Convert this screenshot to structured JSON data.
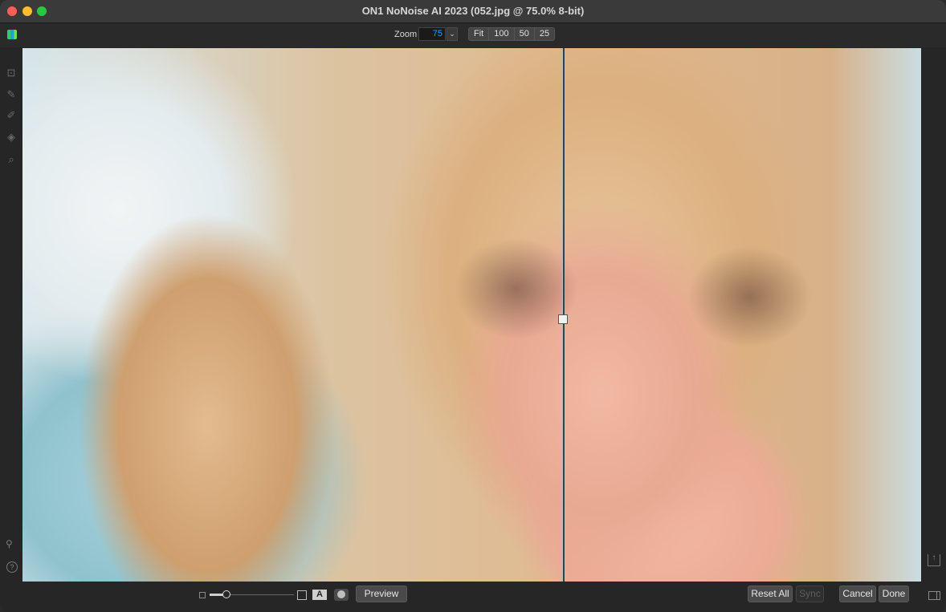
{
  "window": {
    "title": "ON1 NoNoise AI 2023 (052.jpg @ 75.0% 8-bit)"
  },
  "toolbar": {
    "zoom_label": "Zoom",
    "zoom_value": "75",
    "zoom_dropdown_glyph": "⌄",
    "zoom_buttons": [
      "Fit",
      "100",
      "50",
      "25"
    ]
  },
  "left_tools": [
    {
      "icon": "crop-icon",
      "glyph": "⊡"
    },
    {
      "icon": "brush-icon",
      "glyph": "✎"
    },
    {
      "icon": "masking-brush-icon",
      "glyph": "✐"
    },
    {
      "icon": "retouch-icon",
      "glyph": "◈"
    },
    {
      "icon": "zoom-tool-icon",
      "glyph": "⌕"
    }
  ],
  "left_bottom": {
    "user_glyph": "⚲",
    "help_glyph": "?"
  },
  "bottom": {
    "preview_label": "Preview",
    "mask_letter": "A",
    "reset_all_label": "Reset All",
    "sync_label": "Sync",
    "cancel_label": "Cancel",
    "done_label": "Done"
  },
  "right": {
    "export_glyph": "↑"
  }
}
